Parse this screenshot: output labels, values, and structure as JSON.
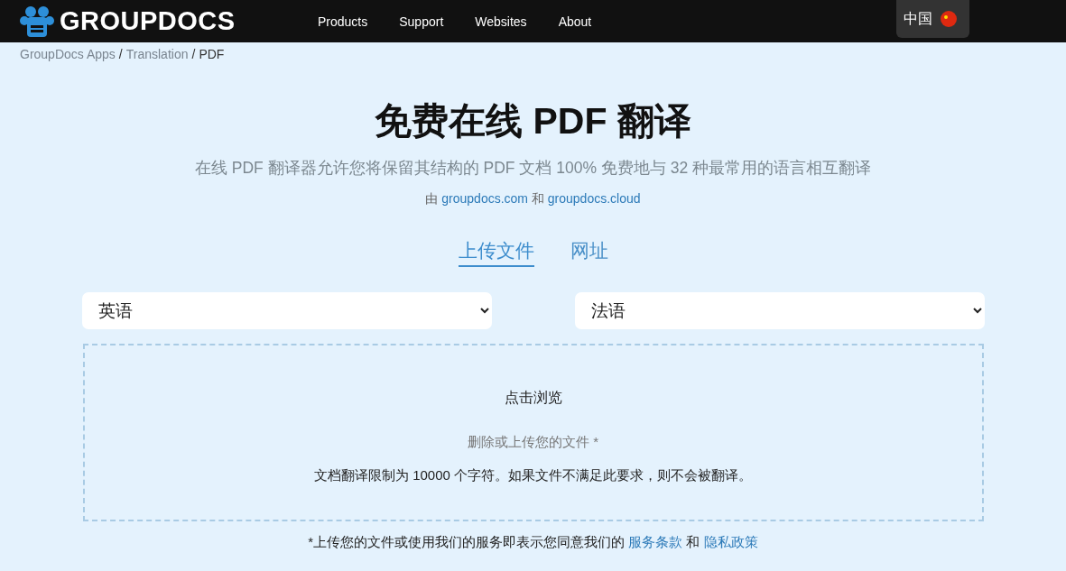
{
  "header": {
    "logo": "GROUPDOCS",
    "nav": [
      "Products",
      "Support",
      "Websites",
      "About"
    ],
    "language": "中国"
  },
  "breadcrumb": {
    "separator": "/",
    "items": [
      {
        "label": "GroupDocs Apps",
        "current": false
      },
      {
        "label": "Translation",
        "current": false
      },
      {
        "label": "PDF",
        "current": true
      }
    ]
  },
  "title": "免费在线 PDF 翻译",
  "subtitle": "在线 PDF 翻译器允许您将保留其结构的 PDF 文档 100% 免费地与 32 种最常用的语言相互翻译",
  "credit": {
    "prefix": "由",
    "link1": "groupdocs.com",
    "joiner": "和",
    "link2": "groupdocs.cloud"
  },
  "tabs": [
    {
      "label": "上传文件",
      "selected": true
    },
    {
      "label": "网址",
      "selected": false
    }
  ],
  "source_language": {
    "value": "英语"
  },
  "target_language": {
    "value": "法语"
  },
  "upload": {
    "button": "点击浏览",
    "hint": "删除或上传您的文件 *",
    "notice": "文档翻译限制为 10000 个字符。如果文件不满足此要求，则不会被翻译。"
  },
  "footer_note": {
    "text": "*上传您的文件或使用我们的服务即表示您同意我们的",
    "terms": "服务条款",
    "joiner": "和",
    "privacy": "隐私政策"
  }
}
